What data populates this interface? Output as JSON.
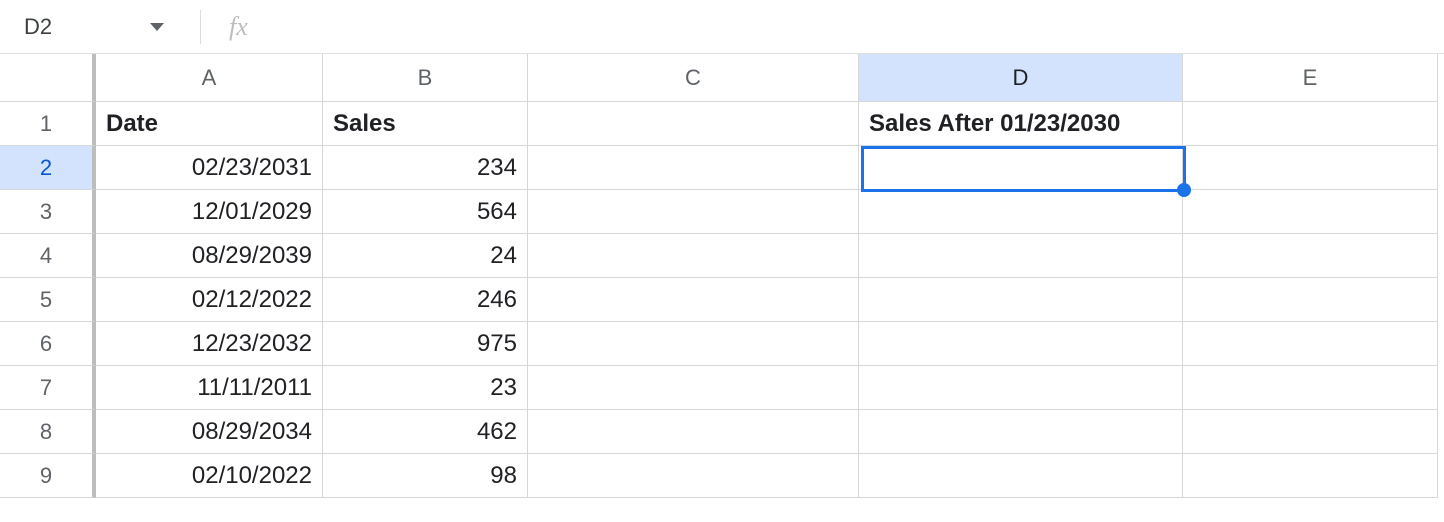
{
  "formula_bar": {
    "name_box": "D2",
    "fx_label": "fx",
    "formula_value": ""
  },
  "columns": [
    "A",
    "B",
    "C",
    "D",
    "E"
  ],
  "selected_column_index": 3,
  "selected_row_index": 1,
  "row_numbers": [
    "1",
    "2",
    "3",
    "4",
    "5",
    "6",
    "7",
    "8",
    "9"
  ],
  "headers": {
    "A": "Date",
    "B": "Sales",
    "D": "Sales After 01/23/2030"
  },
  "rows": [
    {
      "A": "02/23/2031",
      "B": "234"
    },
    {
      "A": "12/01/2029",
      "B": "564"
    },
    {
      "A": "08/29/2039",
      "B": "24"
    },
    {
      "A": "02/12/2022",
      "B": "246"
    },
    {
      "A": "12/23/2032",
      "B": "975"
    },
    {
      "A": "11/11/2011",
      "B": "23"
    },
    {
      "A": "08/29/2034",
      "B": "462"
    },
    {
      "A": "02/10/2022",
      "B": "98"
    }
  ],
  "selection": {
    "cell": "D2"
  }
}
